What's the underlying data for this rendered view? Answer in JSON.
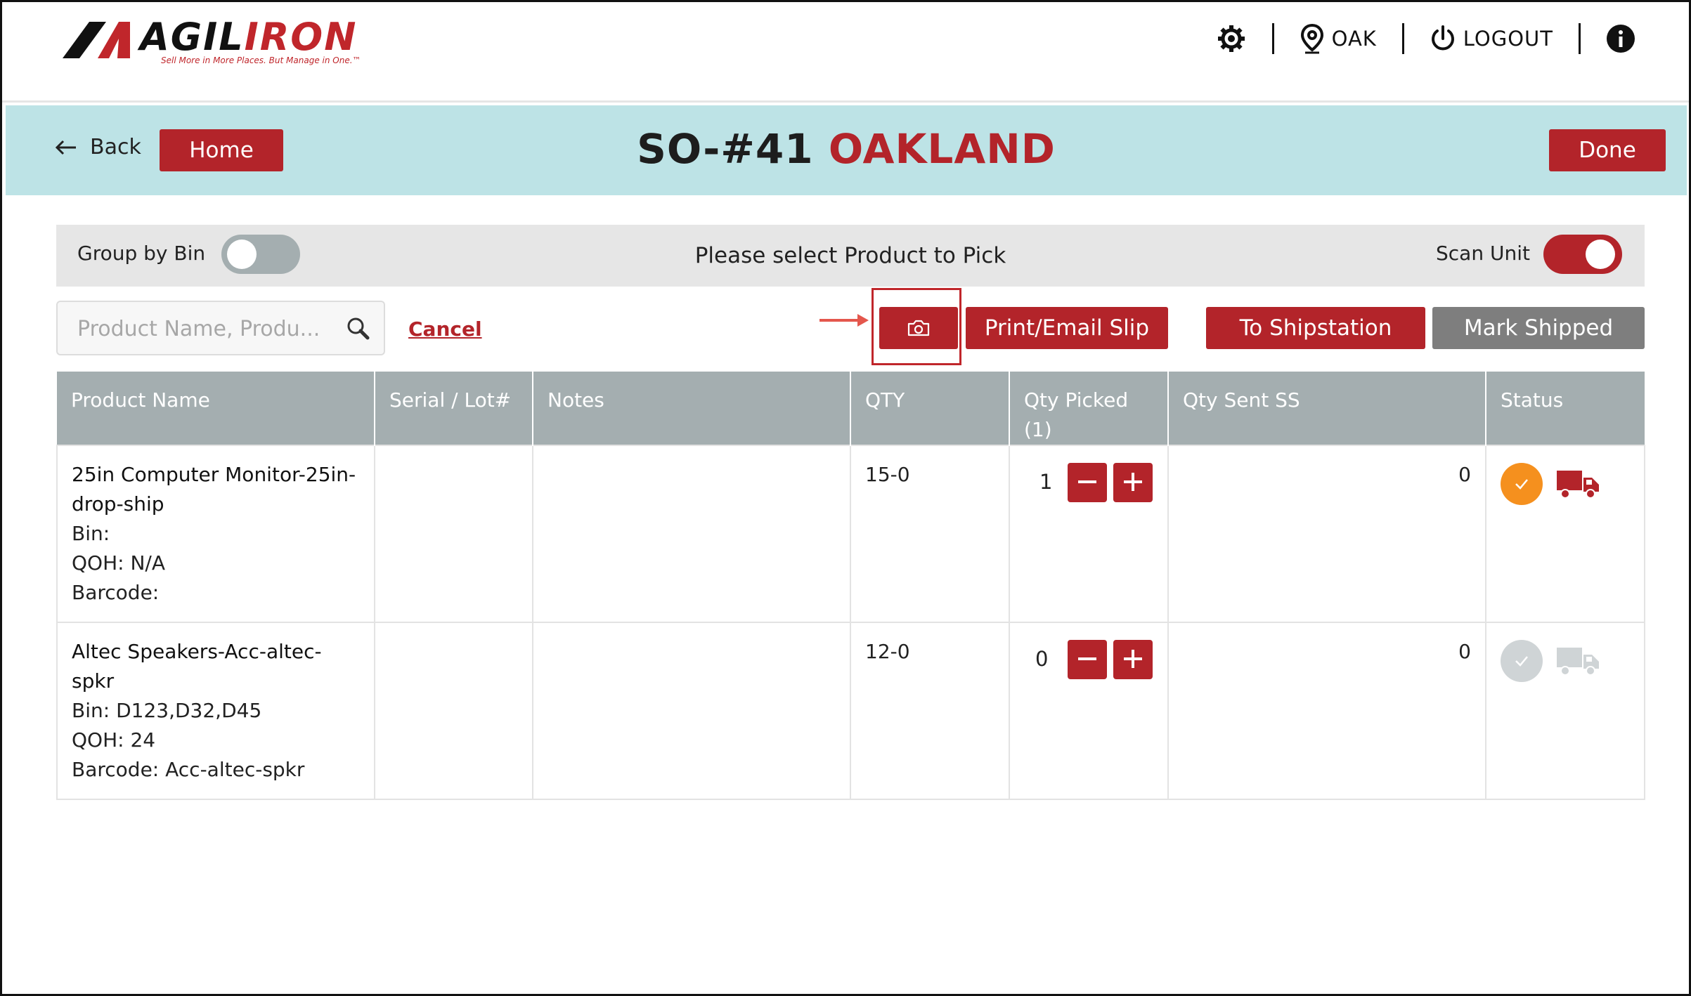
{
  "header": {
    "brand": "AGILIRON",
    "tagline": "Sell More in More Places. But Manage in One.™",
    "location": "OAK",
    "logout": "LOGOUT"
  },
  "title_bar": {
    "back": "Back",
    "home": "Home",
    "order": "SO-#41",
    "location_name": "OAKLAND",
    "done": "Done"
  },
  "options_bar": {
    "group_by_bin": "Group by Bin",
    "group_by_bin_on": false,
    "instruction": "Please select Product to Pick",
    "scan_unit": "Scan Unit",
    "scan_unit_on": true
  },
  "search": {
    "placeholder": "Product Name, Produ...",
    "value": "",
    "cancel": "Cancel"
  },
  "actions": {
    "print_email": "Print/Email Slip",
    "to_shipstation": "To Shipstation",
    "mark_shipped": "Mark Shipped"
  },
  "table": {
    "headers": [
      "Product Name",
      "Serial / Lot#",
      "Notes",
      "QTY",
      "Qty Picked",
      "(1)",
      "Qty Sent SS",
      "Status"
    ],
    "rows": [
      {
        "name": "25in Computer Monitor-25in-drop-ship",
        "bin": "Bin:",
        "qoh": "QOH: N/A",
        "barcode": "Barcode:",
        "serial": "",
        "notes": "",
        "qty": "15-0",
        "picked": "1",
        "sent": "0",
        "status": "picked",
        "status_color": "#f5901e",
        "truck_color": "#b3242a"
      },
      {
        "name": "Altec Speakers-Acc-altec-spkr",
        "bin": "Bin: D123,D32,D45",
        "qoh": "QOH: 24",
        "barcode": "Barcode: Acc-altec-spkr",
        "serial": "",
        "notes": "",
        "qty": "12-0",
        "picked": "0",
        "sent": "0",
        "status": "pending",
        "status_color": "#cfd4d6",
        "truck_color": "#cfd4d6"
      }
    ]
  }
}
